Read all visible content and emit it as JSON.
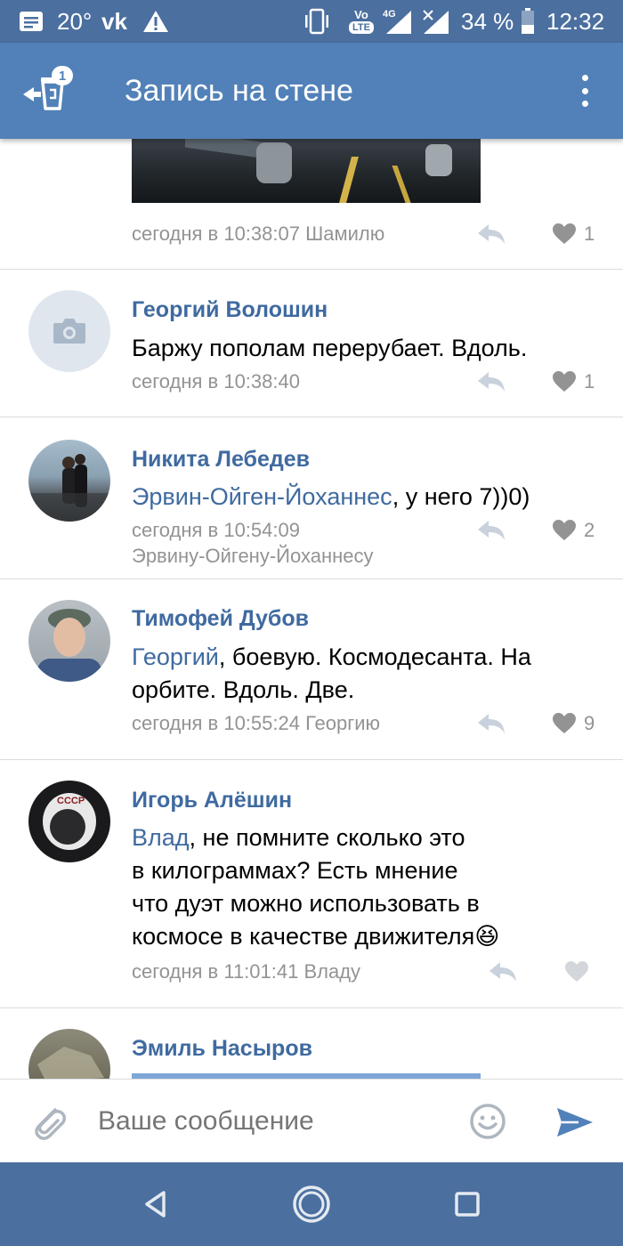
{
  "status_bar": {
    "temperature": "20°",
    "vk": "vk",
    "volte_top": "Vo",
    "volte_bottom": "LTE",
    "network": "4G",
    "battery": "34 %",
    "time": "12:32"
  },
  "header": {
    "title": "Запись на стене",
    "badge": "1"
  },
  "comments": [
    {
      "meta": "сегодня в 10:38:07 Шамилю",
      "likes": "1"
    },
    {
      "author": "Георгий Волошин",
      "text": "Баржу пополам перерубает. Вдоль.",
      "meta": "сегодня в 10:38:40",
      "likes": "1"
    },
    {
      "author": "Никита Лебедев",
      "mention": "Эрвин-Ойген-Йоханнес",
      "text": ", у него 7))0)",
      "meta": "сегодня в 10:54:09",
      "reply_to": "Эрвину-Ойгену-Йоханнесу",
      "likes": "2"
    },
    {
      "author": "Тимофей Дубов",
      "mention": "Георгий",
      "text_line1": ", боевую. Космодесанта. На",
      "text_line2": "орбите. Вдоль. Две.",
      "meta": "сегодня в 10:55:24 Георгию",
      "likes": "9"
    },
    {
      "author": "Игорь Алёшин",
      "mention": "Влад",
      "text_line1": ", не помните сколько это",
      "text_line2": "в килограммах? Есть мнение",
      "text_line3": "что дуэт можно использовать в",
      "text_line4": "космосе в качестве движителя",
      "emoji": "😆",
      "meta": "сегодня в 11:01:41 Владу"
    },
    {
      "author": "Эмиль Насыров"
    }
  ],
  "composer": {
    "placeholder": "Ваше сообщение"
  },
  "colors": {
    "accent": "#5181b8",
    "status_bar": "#4b6f9f",
    "link": "#3f6aa0",
    "meta": "#939393"
  }
}
